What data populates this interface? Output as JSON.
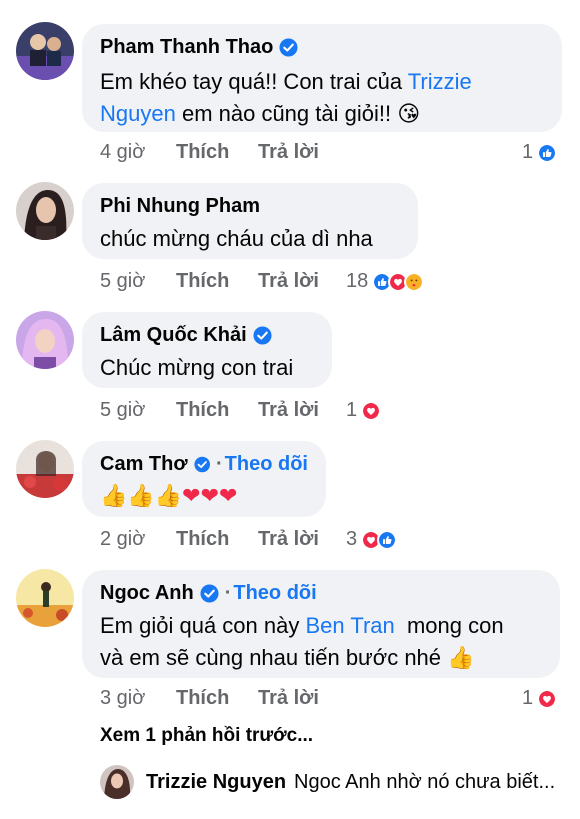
{
  "comments": [
    {
      "name": "Pham Thanh Thao",
      "verified": true,
      "follow": "",
      "text_parts": [
        "Em khéo tay quá!! Con trai của ",
        "Trizzie",
        "Nguyen",
        " em nào cũng tài giỏi!! ",
        "😘"
      ],
      "time": "4 giờ",
      "like": "Thích",
      "reply": "Trả lời",
      "reaction_count": "1",
      "reactions": [
        "like"
      ]
    },
    {
      "name": "Phi Nhung Pham",
      "verified": false,
      "follow": "",
      "text": "chúc mừng cháu của dì nha",
      "time": "5 giờ",
      "like": "Thích",
      "reply": "Trả lời",
      "reaction_count": "18",
      "reactions": [
        "like",
        "love",
        "care"
      ]
    },
    {
      "name": "Lâm Quốc Khải",
      "verified": true,
      "follow": "",
      "text": "Chúc mừng con trai",
      "time": "5 giờ",
      "like": "Thích",
      "reply": "Trả lời",
      "reaction_count": "1",
      "reactions": [
        "love"
      ]
    },
    {
      "name": "Cam Thơ",
      "verified": true,
      "follow": "Theo dõi",
      "text": "👍👍👍❤❤❤",
      "time": "2 giờ",
      "like": "Thích",
      "reply": "Trả lời",
      "reaction_count": "3",
      "reactions": [
        "love",
        "like"
      ]
    },
    {
      "name": "Ngoc Anh",
      "verified": true,
      "follow": "Theo dõi",
      "text_parts": [
        "Em giỏi quá con này ",
        "Ben Tran",
        "  mong con",
        "và em sẽ cùng nhau tiến bước nhé ",
        "👍"
      ],
      "time": "3 giờ",
      "like": "Thích",
      "reply": "Trả lời",
      "reaction_count": "1",
      "reactions": [
        "love"
      ]
    }
  ],
  "more_replies": "Xem 1 phản hồi trước...",
  "latest_reply": {
    "name": "Trizzie Nguyen",
    "text": "Ngoc Anh nhờ nó chưa biết..."
  },
  "colors": {
    "link": "#1877f2",
    "muted": "#65676b",
    "bubble": "#f0f2f5",
    "like": "#1877f2",
    "love": "#f02849",
    "care": "#f7b125"
  }
}
